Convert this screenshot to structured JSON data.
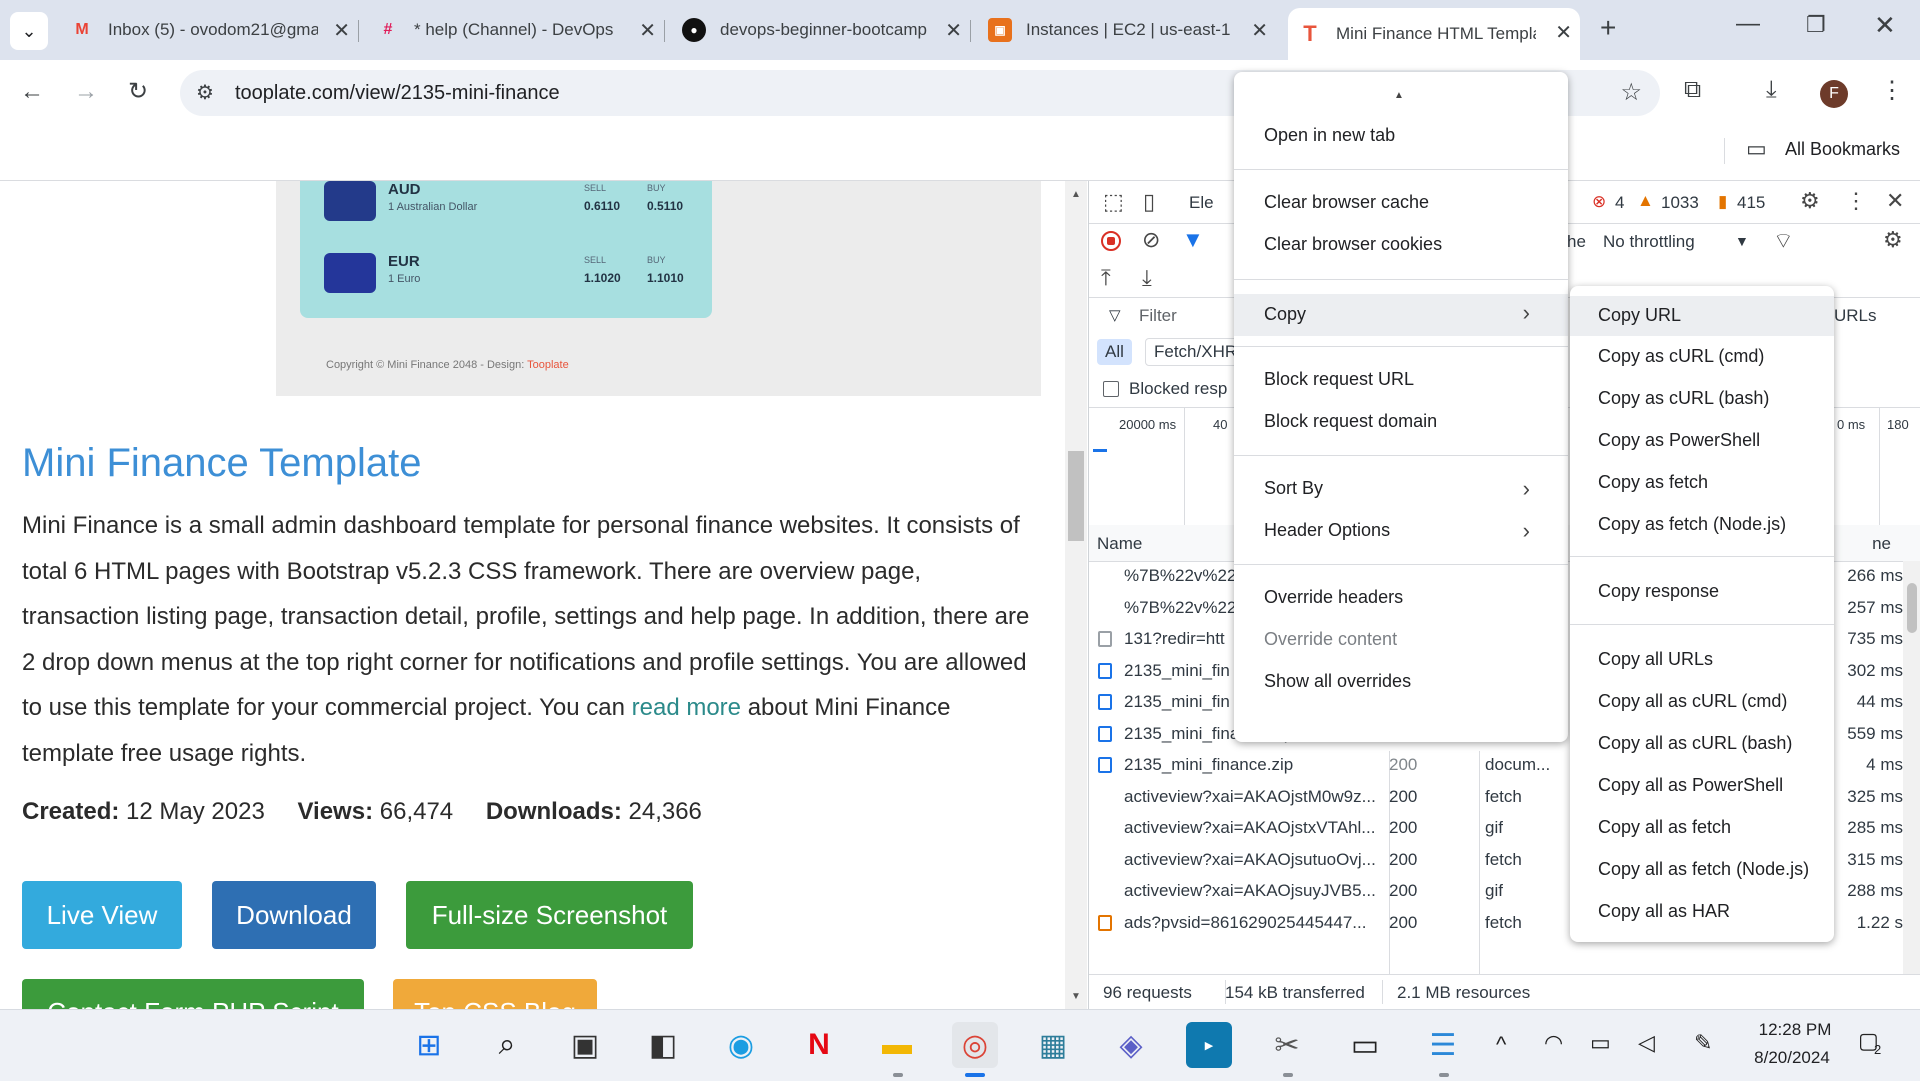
{
  "tabs": [
    {
      "title": "Inbox (5) - ovodom21@gmail.com",
      "icon": "gmail-icon"
    },
    {
      "title": "* help (Channel) - DevOps",
      "icon": "slack-icon"
    },
    {
      "title": "devops-beginner-bootcamp",
      "icon": "github-icon"
    },
    {
      "title": "Instances | EC2 | us-east-1",
      "icon": "aws-icon"
    },
    {
      "title": "Mini Finance HTML Template",
      "icon": "tooplate-icon",
      "active": true
    }
  ],
  "address_bar": {
    "url": "tooplate.com/view/2135-mini-finance"
  },
  "bookmarks_bar": {
    "all_bookmarks": "All Bookmarks"
  },
  "profile_initial": "F",
  "preview": {
    "currencies": [
      {
        "code": "AUD",
        "name": "1 Australian Dollar",
        "sell_label": "SELL",
        "buy_label": "BUY",
        "sell": "0.6110",
        "buy": "0.5110"
      },
      {
        "code": "EUR",
        "name": "1 Euro",
        "sell_label": "SELL",
        "buy_label": "BUY",
        "sell": "1.1020",
        "buy": "1.1010"
      }
    ],
    "copyright": "Copyright © Mini Finance 2048 - Design: ",
    "copyright_link": "Tooplate"
  },
  "page": {
    "title": "Mini Finance Template",
    "description_before": "Mini Finance is a small admin dashboard template for personal finance websites. It consists of total 6 HTML pages with Bootstrap v5.2.3 CSS framework. There are overview page, transaction listing page, transaction detail, profile, settings and help page. In addition, there are 2 drop down menus at the top right corner for notifications and profile settings. You are allowed to use this template for your commercial project. You can ",
    "description_link": "read more",
    "description_after": " about Mini Finance template free usage rights.",
    "created_label": "Created:",
    "created_value": "12 May 2023",
    "views_label": "Views:",
    "views_value": "66,474",
    "downloads_label": "Downloads:",
    "downloads_value": "24,366",
    "buttons": {
      "live_view": "Live View",
      "download": "Download",
      "screenshot": "Full-size Screenshot",
      "contact": "Contact Form PHP Script",
      "top_css": "Top CSS Blog"
    }
  },
  "devtools": {
    "elements_tab": "Ele",
    "errors": "4",
    "warnings": "1033",
    "issues": "415",
    "throttling_prefix": "he",
    "throttling": "No throttling",
    "filter_placeholder": "Filter",
    "filter_all": "All",
    "filter_fetch": "Fetch/XHR",
    "blocked_label": "Blocked resp",
    "urls_label": "URLs",
    "timeline_left": "20000 ms",
    "timeline_next": "40",
    "timeline_right_a": "0 ms",
    "timeline_right_b": "180",
    "name_header": "Name",
    "time_header": "ne",
    "rows": [
      {
        "name": "%7B%22v%22",
        "status": "",
        "type": "",
        "time": "266 ms",
        "icon": "none"
      },
      {
        "name": "%7B%22v%22",
        "status": "",
        "type": "",
        "time": "257 ms",
        "icon": "none"
      },
      {
        "name": "131?redir=htt",
        "status": "",
        "type": "",
        "time": "735 ms",
        "icon": "image"
      },
      {
        "name": "2135_mini_fin",
        "status": "",
        "type": "",
        "time": "302 ms",
        "icon": "doc"
      },
      {
        "name": "2135_mini_fin",
        "status": "",
        "type": "",
        "time": "44 ms",
        "icon": "doc"
      },
      {
        "name": "2135_mini_finance.zip",
        "status": "200",
        "type": "docum...",
        "time": "559 ms",
        "icon": "doc"
      },
      {
        "name": "2135_mini_finance.zip",
        "status": "200",
        "type": "docum...",
        "time": "4 ms",
        "icon": "doc"
      },
      {
        "name": "activeview?xai=AKAOjstM0w9z...",
        "status": "200",
        "type": "fetch",
        "time": "325 ms",
        "icon": "none"
      },
      {
        "name": "activeview?xai=AKAOjstxVTAhl...",
        "status": "200",
        "type": "gif",
        "time": "285 ms",
        "icon": "none"
      },
      {
        "name": "activeview?xai=AKAOjsutuoOvj...",
        "status": "200",
        "type": "fetch",
        "time": "315 ms",
        "icon": "none"
      },
      {
        "name": "activeview?xai=AKAOjsuyJVB5...",
        "status": "200",
        "type": "gif",
        "time": "288 ms",
        "icon": "none"
      },
      {
        "name": "ads?pvsid=861629025445447...",
        "status": "200",
        "type": "fetch",
        "time": "1.22 s",
        "icon": "orange"
      }
    ],
    "status_requests": "96 requests",
    "status_transferred": "154 kB transferred",
    "status_resources": "2.1 MB resources"
  },
  "context_menu": {
    "items": [
      "Open in new tab",
      "Clear browser cache",
      "Clear browser cookies",
      "Copy",
      "Block request URL",
      "Block request domain",
      "Sort By",
      "Header Options",
      "Override headers",
      "Override content",
      "Show all overrides"
    ]
  },
  "copy_submenu": {
    "items": [
      "Copy URL",
      "Copy as cURL (cmd)",
      "Copy as cURL (bash)",
      "Copy as PowerShell",
      "Copy as fetch",
      "Copy as fetch (Node.js)",
      "Copy response",
      "Copy all URLs",
      "Copy all as cURL (cmd)",
      "Copy all as cURL (bash)",
      "Copy all as PowerShell",
      "Copy all as fetch",
      "Copy all as fetch (Node.js)",
      "Copy all as HAR"
    ]
  },
  "taskbar": {
    "time": "12:28 PM",
    "date": "8/20/2024",
    "notifications": "2",
    "apps": [
      "windows-start-icon",
      "search-icon",
      "task-view-icon",
      "widgets-icon",
      "edge-icon",
      "netflix-icon",
      "file-explorer-icon",
      "chrome-icon",
      "microsoft-store-icon",
      "teams-icon",
      "prime-video-icon",
      "snipping-tool-icon",
      "terminal-icon",
      "notepad-icon"
    ]
  },
  "colors": {
    "title_blue": "#3d8fd6",
    "live_view": "#33aadd",
    "download": "#2e6fb3",
    "green": "#3c9b3c",
    "orange": "#f0a93a"
  }
}
